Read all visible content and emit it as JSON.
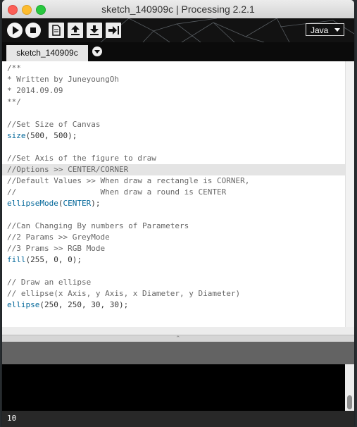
{
  "window": {
    "title": "sketch_140909c | Processing 2.2.1"
  },
  "toolbar": {
    "buttons": [
      {
        "name": "run-button",
        "icon": "play-icon"
      },
      {
        "name": "stop-button",
        "icon": "stop-icon"
      },
      {
        "name": "new-button",
        "icon": "new-file-icon"
      },
      {
        "name": "open-button",
        "icon": "upload-arrow-icon"
      },
      {
        "name": "save-button",
        "icon": "download-arrow-icon"
      },
      {
        "name": "export-button",
        "icon": "export-arrow-icon"
      }
    ],
    "mode": "Java"
  },
  "tabs": {
    "active_label": "sketch_140909c"
  },
  "editor": {
    "current_line_index": 9,
    "lines": [
      [
        {
          "t": "/**",
          "c": "comment"
        }
      ],
      [
        {
          "t": "* Written by JuneyoungOh",
          "c": "comment"
        }
      ],
      [
        {
          "t": "* 2014.09.09",
          "c": "comment"
        }
      ],
      [
        {
          "t": "**/",
          "c": "comment"
        }
      ],
      [],
      [
        {
          "t": "//Set Size of Canvas",
          "c": "comment"
        }
      ],
      [
        {
          "t": "size",
          "c": "kw"
        },
        {
          "t": "(500, 500);",
          "c": "plain"
        }
      ],
      [],
      [
        {
          "t": "//Set Axis of the figure to draw",
          "c": "comment"
        }
      ],
      [
        {
          "t": "//Options >> CENTER/CORNER",
          "c": "comment"
        }
      ],
      [
        {
          "t": "//Default Values >> When draw a rectangle is CORNER,",
          "c": "comment"
        }
      ],
      [
        {
          "t": "//                  When draw a round is CENTER",
          "c": "comment"
        }
      ],
      [
        {
          "t": "ellipseMode",
          "c": "kw"
        },
        {
          "t": "(",
          "c": "plain"
        },
        {
          "t": "CENTER",
          "c": "kw"
        },
        {
          "t": ");",
          "c": "plain"
        }
      ],
      [],
      [
        {
          "t": "//Can Changing By numbers of Parameters",
          "c": "comment"
        }
      ],
      [
        {
          "t": "//2 Params >> GreyMode",
          "c": "comment"
        }
      ],
      [
        {
          "t": "//3 Prams >> RGB Mode",
          "c": "comment"
        }
      ],
      [
        {
          "t": "fill",
          "c": "kw"
        },
        {
          "t": "(255, 0, 0);",
          "c": "plain"
        }
      ],
      [],
      [
        {
          "t": "// Draw an ellipse",
          "c": "comment"
        }
      ],
      [
        {
          "t": "// ellipse(x Axis, y Axis, x Diameter, y Diameter)",
          "c": "comment"
        }
      ],
      [
        {
          "t": "ellipse",
          "c": "kw"
        },
        {
          "t": "(250, 250, 30, 30);",
          "c": "plain"
        }
      ]
    ]
  },
  "status": {
    "line_number": "10"
  },
  "colors": {
    "keyword": "#006699",
    "comment": "#666666",
    "plain": "#333333",
    "current_line_bg": "#e4e4e4",
    "toolbar_bg": "#121212"
  }
}
